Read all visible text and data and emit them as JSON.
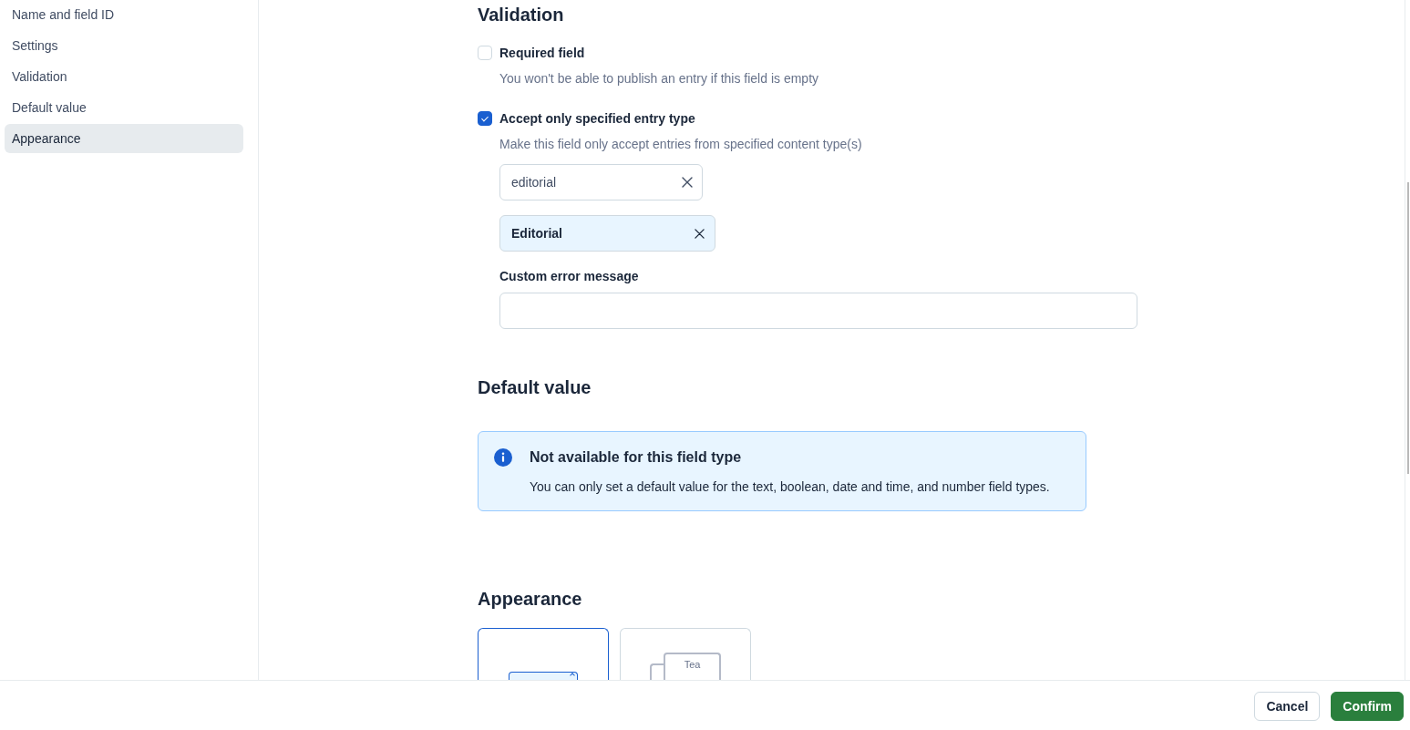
{
  "sidebar": {
    "items": [
      {
        "label": "Name and field ID",
        "selected": false
      },
      {
        "label": "Settings",
        "selected": false
      },
      {
        "label": "Validation",
        "selected": false
      },
      {
        "label": "Default value",
        "selected": false
      },
      {
        "label": "Appearance",
        "selected": true
      }
    ]
  },
  "validation": {
    "heading": "Validation",
    "options": [
      {
        "label": "Required field",
        "checked": false,
        "help": "You won't be able to publish an entry if this field is empty"
      },
      {
        "label": "Accept only specified entry type",
        "checked": true,
        "help": "Make this field only accept entries from specified content type(s)",
        "search": {
          "value": "editorial"
        },
        "tags": [
          {
            "label": "Editorial"
          }
        ],
        "custom_error": {
          "label": "Custom error message"
        }
      }
    ]
  },
  "default_value": {
    "heading": "Default value",
    "notice": {
      "kind": "info",
      "title": "Not available for this field type",
      "body": "You can only set a default value for the text, boolean, date and time, and number field types."
    }
  },
  "appearance": {
    "heading": "Appearance",
    "options": [
      {
        "kind": "link",
        "selected": true
      },
      {
        "kind": "card",
        "selected": false,
        "preview_text": "Tea"
      }
    ]
  },
  "footer": {
    "buttons": [
      {
        "label": "Cancel",
        "kind": "cancel"
      },
      {
        "label": "Confirm",
        "kind": "confirm"
      }
    ]
  }
}
